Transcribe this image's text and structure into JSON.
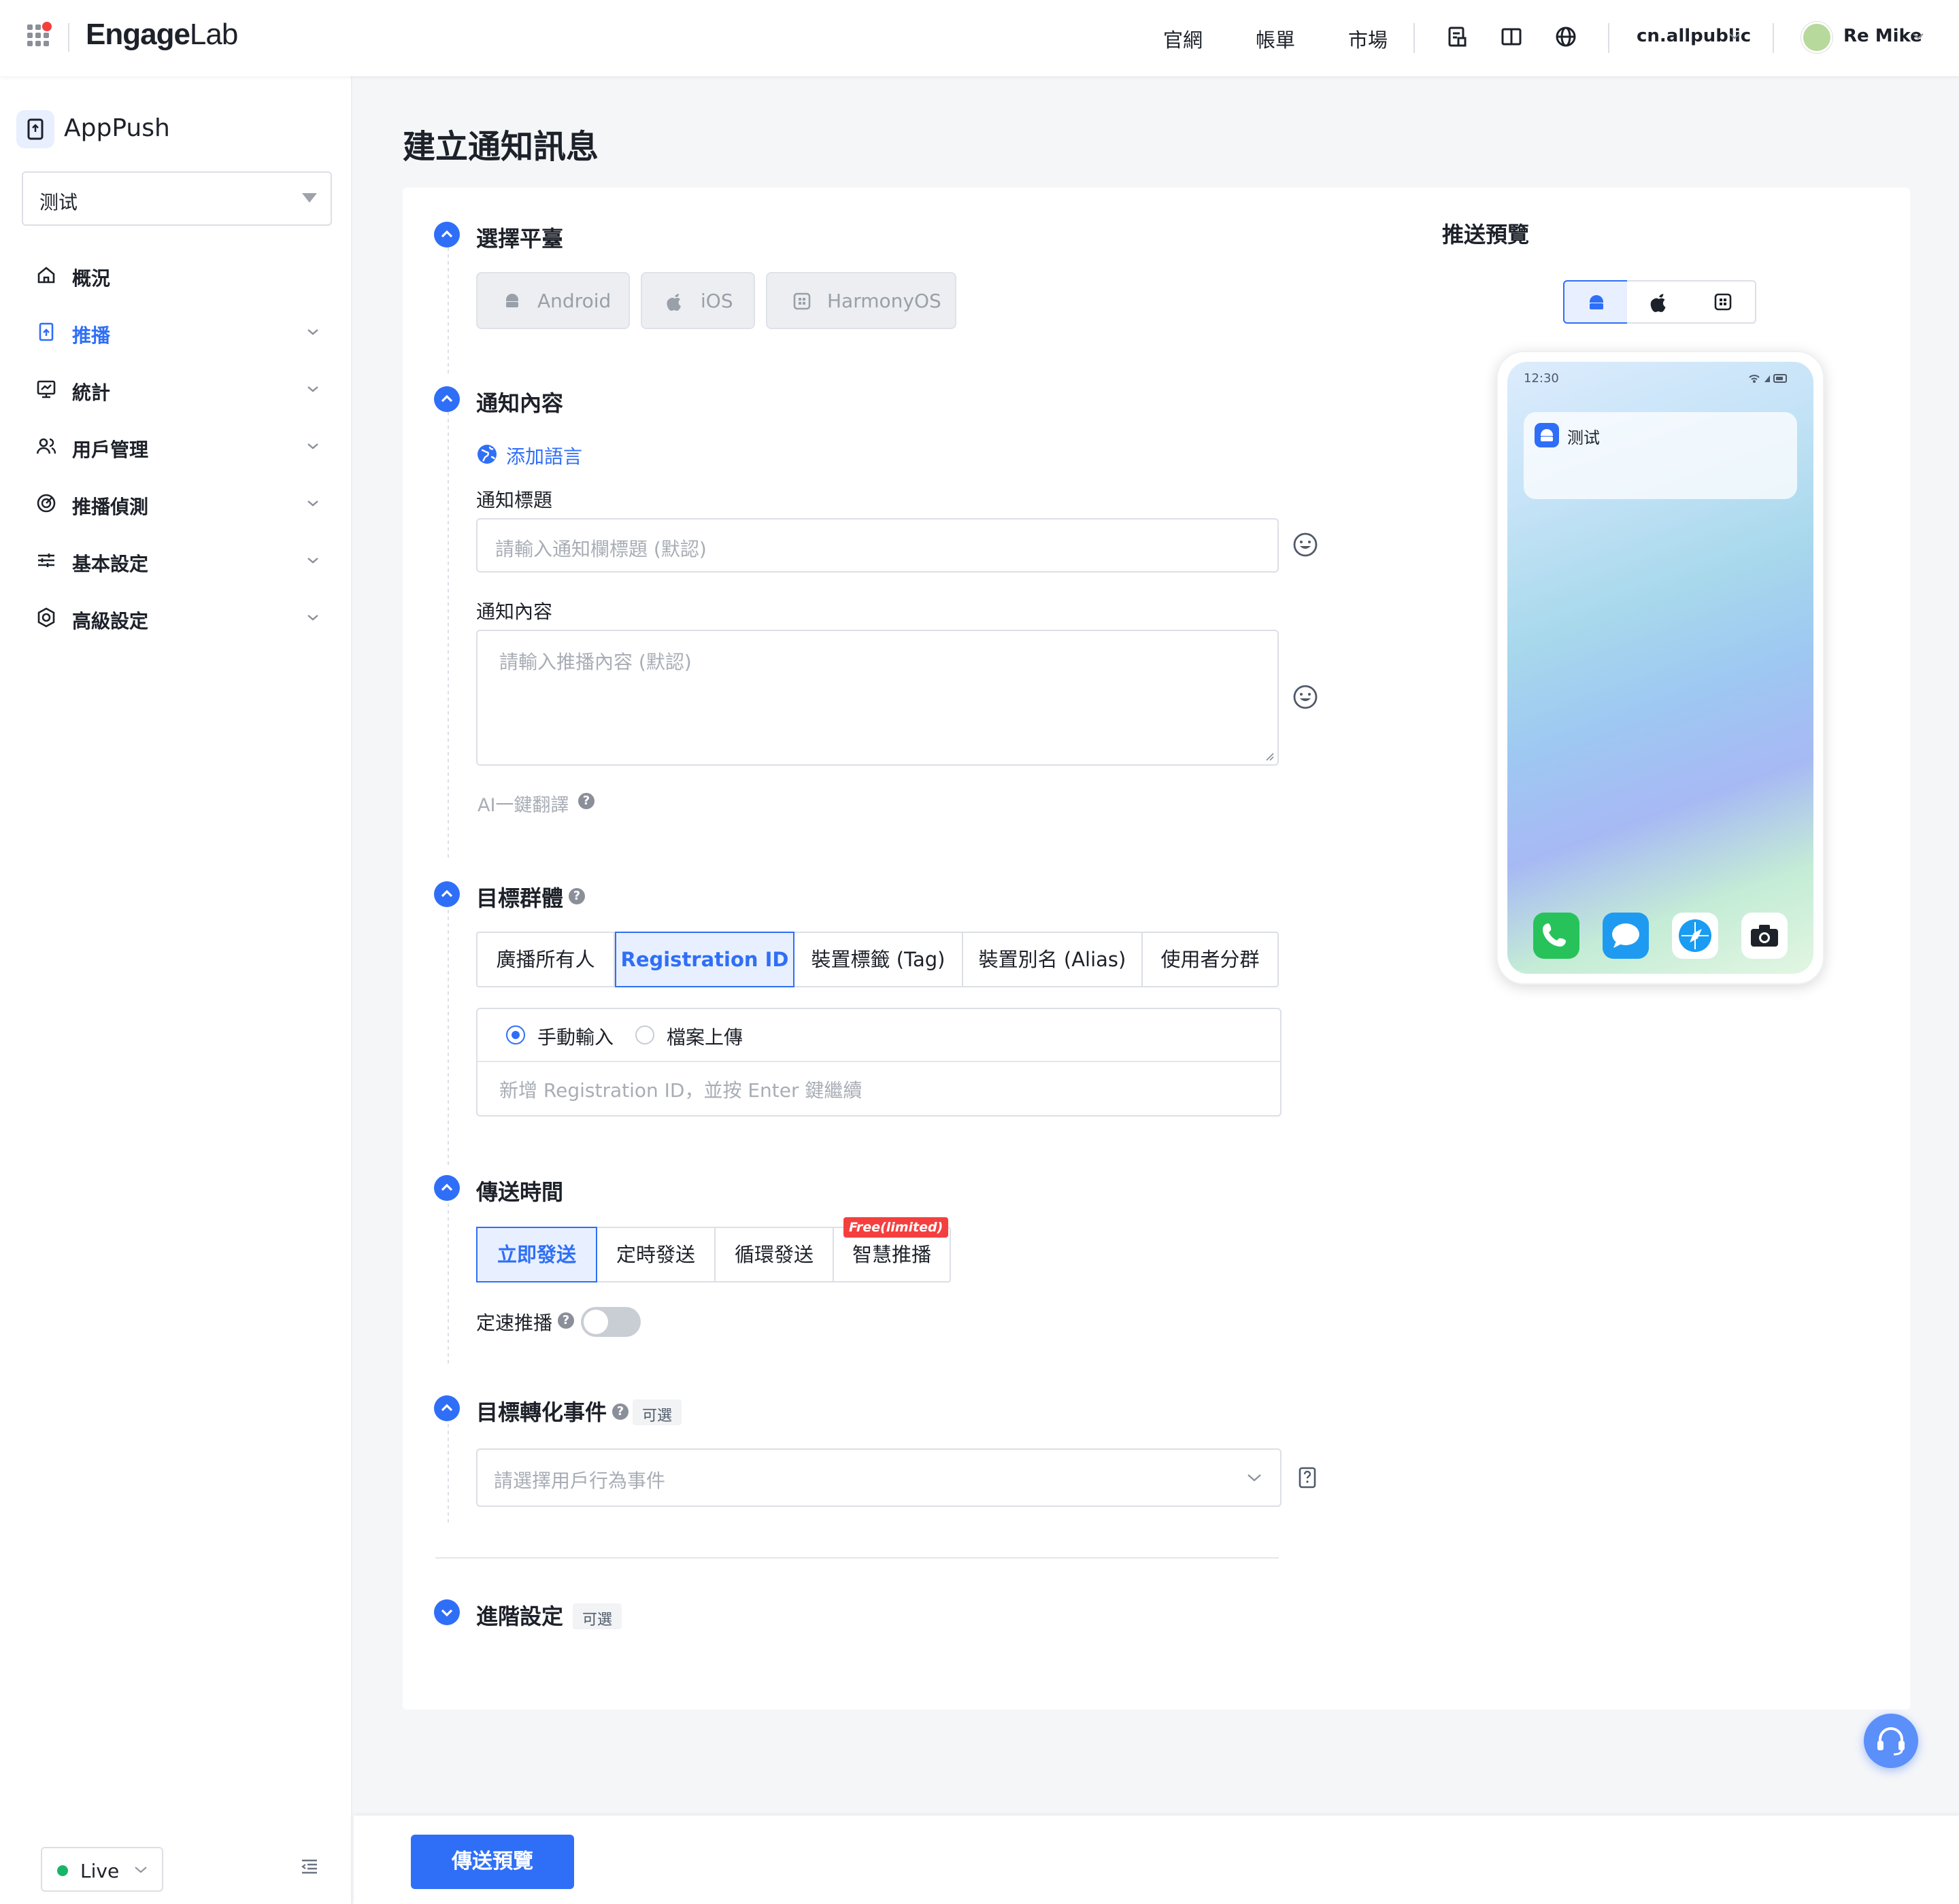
{
  "topbar": {
    "brand_main": "Engage",
    "brand_lab": "Lab",
    "nav": [
      "官網",
      "帳單",
      "市場"
    ],
    "account": "cn.allpublic",
    "user": "Re Mike"
  },
  "sidebar": {
    "app_name": "AppPush",
    "app_selected": "测试",
    "items": [
      {
        "label": "概況",
        "icon": "home-icon",
        "expandable": false
      },
      {
        "label": "推播",
        "icon": "push-icon",
        "expandable": true,
        "active": true
      },
      {
        "label": "統計",
        "icon": "chart-icon",
        "expandable": true
      },
      {
        "label": "用戶管理",
        "icon": "users-icon",
        "expandable": true
      },
      {
        "label": "推播偵測",
        "icon": "radar-icon",
        "expandable": true
      },
      {
        "label": "基本設定",
        "icon": "sliders-icon",
        "expandable": true
      },
      {
        "label": "高級設定",
        "icon": "gear-icon",
        "expandable": true
      }
    ],
    "env": "Live"
  },
  "page": {
    "title": "建立通知訊息"
  },
  "platform": {
    "title": "選擇平臺",
    "options": [
      "Android",
      "iOS",
      "HarmonyOS"
    ]
  },
  "content": {
    "title": "通知內容",
    "add_language": "添加語言",
    "title_label": "通知標題",
    "title_placeholder": "請輸入通知欄標題 (默認)",
    "body_label": "通知內容",
    "body_placeholder": "請輸入推播內容 (默認)",
    "ai_translate": "AI一鍵翻譯"
  },
  "audience": {
    "title": "目標群體",
    "tabs": [
      "廣播所有人",
      "Registration ID",
      "裝置標籤 (Tag)",
      "裝置別名 (Alias)",
      "使用者分群"
    ],
    "selected_tab": "Registration ID",
    "input_modes": [
      "手動輸入",
      "檔案上傳"
    ],
    "selected_mode": "手動輸入",
    "input_placeholder": "新增 Registration ID，並按 Enter 鍵繼續"
  },
  "schedule": {
    "title": "傳送時間",
    "tabs": [
      "立即發送",
      "定時發送",
      "循環發送",
      "智慧推播"
    ],
    "selected_tab": "立即發送",
    "badge": "Free(limited)",
    "rate_label": "定速推播",
    "rate_enabled": false
  },
  "conversion": {
    "title": "目標轉化事件",
    "optional": "可選",
    "placeholder": "請選擇用戶行為事件"
  },
  "advanced": {
    "title": "進階設定",
    "optional": "可選"
  },
  "preview": {
    "title": "推送預覽",
    "platforms": [
      "android-icon",
      "apple-icon",
      "harmony-icon"
    ],
    "selected_platform": "android-icon",
    "time": "12:30",
    "app_name": "测试"
  },
  "footer": {
    "button": "傳送預覽"
  },
  "colors": {
    "accent": "#2f6ff7",
    "live": "#18b566",
    "badge": "#f53f3f"
  }
}
